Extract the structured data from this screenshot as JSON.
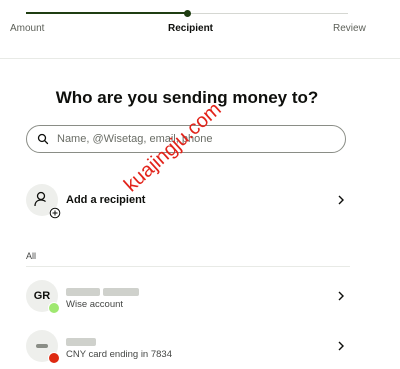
{
  "progress": {
    "steps": [
      "Amount",
      "Recipient",
      "Review"
    ],
    "current": 2,
    "completed_fraction": 0.5
  },
  "heading": "Who are you sending money to?",
  "search": {
    "placeholder": "Name, @Wisetag, email, phone",
    "value": ""
  },
  "add_recipient": {
    "label": "Add a recipient"
  },
  "section_label": "All",
  "recipients": [
    {
      "initials": "GR",
      "name": "",
      "subtitle": "Wise account",
      "badge": "wise",
      "badge_color": "#9fe870"
    },
    {
      "initials": "",
      "name": "",
      "subtitle": "CNY card ending in 7834",
      "badge": "china-flag",
      "badge_color": "#de2910"
    }
  ],
  "watermark": "kuajingju.com",
  "colors": {
    "accent": "#1f3d12",
    "text": "#0e0f0c",
    "muted": "#6a6d66"
  }
}
